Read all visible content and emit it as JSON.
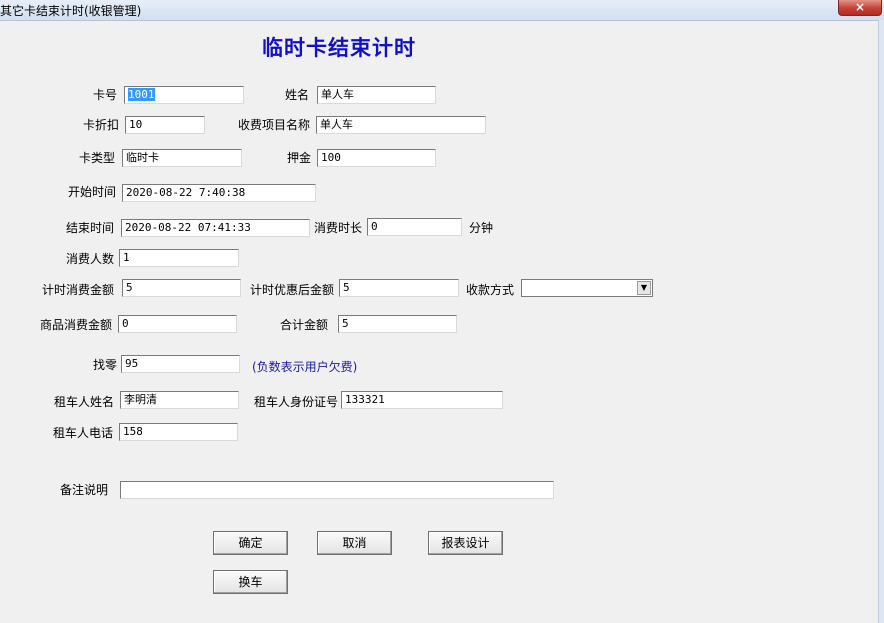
{
  "window": {
    "title": "其它卡结束计时(收银管理)",
    "close_icon": "×"
  },
  "heading": "临时卡结束计时",
  "fields": {
    "card_no": {
      "label": "卡号",
      "value": "1001"
    },
    "name": {
      "label": "姓名",
      "value": "单人车"
    },
    "discount": {
      "label": "卡折扣",
      "value": "10"
    },
    "charge_item": {
      "label": "收费项目名称",
      "value": "单人车"
    },
    "card_type": {
      "label": "卡类型",
      "value": "临时卡"
    },
    "deposit": {
      "label": "押金",
      "value": "100"
    },
    "start_time": {
      "label": "开始时间",
      "value": "2020-08-22 7:40:38"
    },
    "end_time": {
      "label": "结束时间",
      "value": "2020-08-22 07:41:33"
    },
    "duration": {
      "label": "消费时长",
      "value": "0",
      "unit": "分钟"
    },
    "people": {
      "label": "消费人数",
      "value": "1"
    },
    "timed_amount": {
      "label": "计时消费金额",
      "value": "5"
    },
    "after_discount": {
      "label": "计时优惠后金额",
      "value": "5"
    },
    "payment_method": {
      "label": "收款方式",
      "value": ""
    },
    "goods_amount": {
      "label": "商品消费金额",
      "value": "0"
    },
    "total": {
      "label": "合计金额",
      "value": "5"
    },
    "change": {
      "label": "找零",
      "value": "95",
      "note": "(负数表示用户欠费)"
    },
    "renter_name": {
      "label": "租车人姓名",
      "value": "李明清"
    },
    "renter_id": {
      "label": "租车人身份证号",
      "value": "133321"
    },
    "renter_phone": {
      "label": "租车人电话",
      "value": "158"
    },
    "remark": {
      "label": "备注说明",
      "value": ""
    }
  },
  "buttons": {
    "ok": "确定",
    "cancel": "取消",
    "report_design": "报表设计",
    "change_car": "换车"
  }
}
